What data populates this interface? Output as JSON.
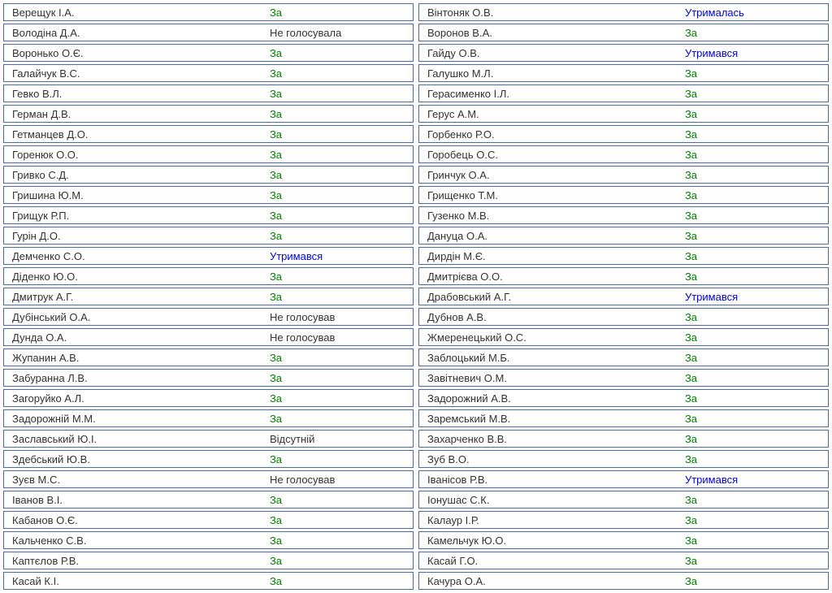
{
  "left": [
    {
      "name": "Верещук І.А.",
      "vote": "За",
      "cls": "vote-za"
    },
    {
      "name": "Володіна Д.А.",
      "vote": "Не голосувала",
      "cls": "vote-novote"
    },
    {
      "name": "Воронько О.Є.",
      "vote": "За",
      "cls": "vote-za"
    },
    {
      "name": "Галайчук В.С.",
      "vote": "За",
      "cls": "vote-za"
    },
    {
      "name": "Гевко В.Л.",
      "vote": "За",
      "cls": "vote-za"
    },
    {
      "name": "Герман Д.В.",
      "vote": "За",
      "cls": "vote-za"
    },
    {
      "name": "Гетманцев Д.О.",
      "vote": "За",
      "cls": "vote-za"
    },
    {
      "name": "Горенюк О.О.",
      "vote": "За",
      "cls": "vote-za"
    },
    {
      "name": "Гривко С.Д.",
      "vote": "За",
      "cls": "vote-za"
    },
    {
      "name": "Гришина Ю.М.",
      "vote": "За",
      "cls": "vote-za"
    },
    {
      "name": "Грищук Р.П.",
      "vote": "За",
      "cls": "vote-za"
    },
    {
      "name": "Гурін Д.О.",
      "vote": "За",
      "cls": "vote-za"
    },
    {
      "name": "Демченко С.О.",
      "vote": "Утримався",
      "cls": "vote-abstain"
    },
    {
      "name": "Діденко Ю.О.",
      "vote": "За",
      "cls": "vote-za"
    },
    {
      "name": "Дмитрук А.Г.",
      "vote": "За",
      "cls": "vote-za"
    },
    {
      "name": "Дубінський О.А.",
      "vote": "Не голосував",
      "cls": "vote-novote"
    },
    {
      "name": "Дунда О.А.",
      "vote": "Не голосував",
      "cls": "vote-novote"
    },
    {
      "name": "Жупанин А.В.",
      "vote": "За",
      "cls": "vote-za"
    },
    {
      "name": "Забуранна Л.В.",
      "vote": "За",
      "cls": "vote-za"
    },
    {
      "name": "Загоруйко А.Л.",
      "vote": "За",
      "cls": "vote-za"
    },
    {
      "name": "Задорожній М.М.",
      "vote": "За",
      "cls": "vote-za"
    },
    {
      "name": "Заславський Ю.І.",
      "vote": "Відсутній",
      "cls": "vote-absent"
    },
    {
      "name": "Здебський Ю.В.",
      "vote": "За",
      "cls": "vote-za"
    },
    {
      "name": "Зуєв М.С.",
      "vote": "Не голосував",
      "cls": "vote-novote"
    },
    {
      "name": "Іванов В.І.",
      "vote": "За",
      "cls": "vote-za"
    },
    {
      "name": "Кабанов О.Є.",
      "vote": "За",
      "cls": "vote-za"
    },
    {
      "name": "Кальченко С.В.",
      "vote": "За",
      "cls": "vote-za"
    },
    {
      "name": "Каптєлов Р.В.",
      "vote": "За",
      "cls": "vote-za"
    },
    {
      "name": "Касай К.І.",
      "vote": "За",
      "cls": "vote-za"
    }
  ],
  "right": [
    {
      "name": "Вінтоняк О.В.",
      "vote": "Утрималась",
      "cls": "vote-abstain"
    },
    {
      "name": "Воронов В.А.",
      "vote": "За",
      "cls": "vote-za"
    },
    {
      "name": "Гайду О.В.",
      "vote": "Утримався",
      "cls": "vote-abstain"
    },
    {
      "name": "Галушко М.Л.",
      "vote": "За",
      "cls": "vote-za"
    },
    {
      "name": "Герасименко І.Л.",
      "vote": "За",
      "cls": "vote-za"
    },
    {
      "name": "Герус А.М.",
      "vote": "За",
      "cls": "vote-za"
    },
    {
      "name": "Горбенко Р.О.",
      "vote": "За",
      "cls": "vote-za"
    },
    {
      "name": "Горобець О.С.",
      "vote": "За",
      "cls": "vote-za"
    },
    {
      "name": "Гринчук О.А.",
      "vote": "За",
      "cls": "vote-za"
    },
    {
      "name": "Грищенко Т.М.",
      "vote": "За",
      "cls": "vote-za"
    },
    {
      "name": "Гузенко М.В.",
      "vote": "За",
      "cls": "vote-za"
    },
    {
      "name": "Дануца О.А.",
      "vote": "За",
      "cls": "vote-za"
    },
    {
      "name": "Дирдін М.Є.",
      "vote": "За",
      "cls": "vote-za"
    },
    {
      "name": "Дмитрієва О.О.",
      "vote": "За",
      "cls": "vote-za"
    },
    {
      "name": "Драбовський А.Г.",
      "vote": "Утримався",
      "cls": "vote-abstain"
    },
    {
      "name": "Дубнов А.В.",
      "vote": "За",
      "cls": "vote-za"
    },
    {
      "name": "Жмеренецький О.С.",
      "vote": "За",
      "cls": "vote-za"
    },
    {
      "name": "Заблоцький М.Б.",
      "vote": "За",
      "cls": "vote-za"
    },
    {
      "name": "Завітневич О.М.",
      "vote": "За",
      "cls": "vote-za"
    },
    {
      "name": "Задорожний А.В.",
      "vote": "За",
      "cls": "vote-za"
    },
    {
      "name": "Заремський М.В.",
      "vote": "За",
      "cls": "vote-za"
    },
    {
      "name": "Захарченко В.В.",
      "vote": "За",
      "cls": "vote-za"
    },
    {
      "name": "Зуб В.О.",
      "vote": "За",
      "cls": "vote-za"
    },
    {
      "name": "Іванісов Р.В.",
      "vote": "Утримався",
      "cls": "vote-abstain"
    },
    {
      "name": "Іонушас С.К.",
      "vote": "За",
      "cls": "vote-za"
    },
    {
      "name": "Калаур І.Р.",
      "vote": "За",
      "cls": "vote-za"
    },
    {
      "name": "Камельчук Ю.О.",
      "vote": "За",
      "cls": "vote-za"
    },
    {
      "name": "Касай Г.О.",
      "vote": "За",
      "cls": "vote-za"
    },
    {
      "name": "Качура О.А.",
      "vote": "За",
      "cls": "vote-za"
    }
  ]
}
